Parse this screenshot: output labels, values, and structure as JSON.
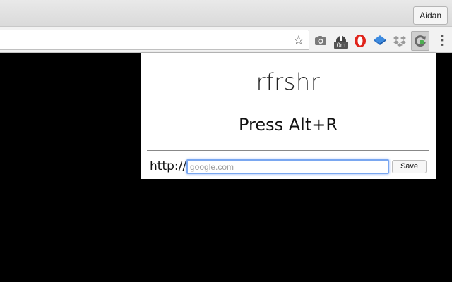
{
  "browser": {
    "profile_name": "Aidan"
  },
  "toolbar": {
    "extensions": [
      {
        "name": "camera-icon"
      },
      {
        "name": "timer-icon",
        "badge": "0m"
      },
      {
        "name": "opera-icon"
      },
      {
        "name": "bookmark-icon"
      },
      {
        "name": "dropbox-icon"
      },
      {
        "name": "refresh-extension-icon"
      }
    ]
  },
  "popup": {
    "title": "rfrshr",
    "shortcut_text": "Press Alt+R",
    "url_prefix": "http://",
    "url_input": {
      "value": "",
      "placeholder": "google.com"
    },
    "save_label": "Save"
  }
}
